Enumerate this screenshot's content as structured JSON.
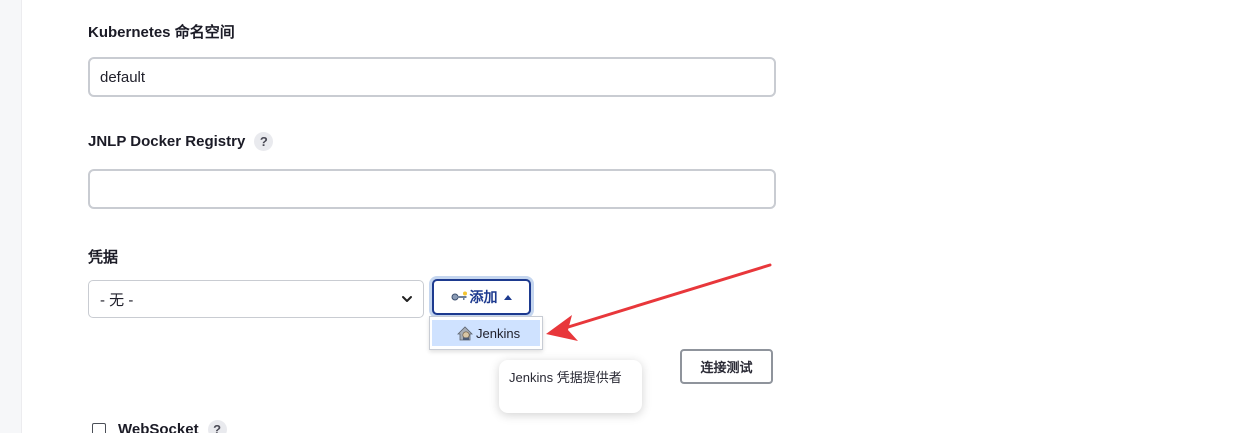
{
  "fields": {
    "namespace": {
      "label": "Kubernetes 命名空间",
      "value": "default"
    },
    "jnlp_registry": {
      "label": "JNLP Docker Registry",
      "help": "?",
      "value": "",
      "placeholder": ""
    },
    "credentials": {
      "label": "凭据",
      "selected": "- 无 -",
      "add_button": "添加",
      "dropdown_items": [
        "Jenkins"
      ],
      "tooltip": "Jenkins 凭据提供者"
    }
  },
  "test_connection_button": "连接测试",
  "websocket": {
    "label": "WebSocket",
    "help": "?",
    "checked": false
  },
  "colors": {
    "primary": "#1d3a8f",
    "highlight": "#cfe2ff",
    "annotation_arrow": "#e8373b"
  },
  "icons": {
    "add_button": "key-icon",
    "dropdown_item": "jenkins-icon"
  }
}
